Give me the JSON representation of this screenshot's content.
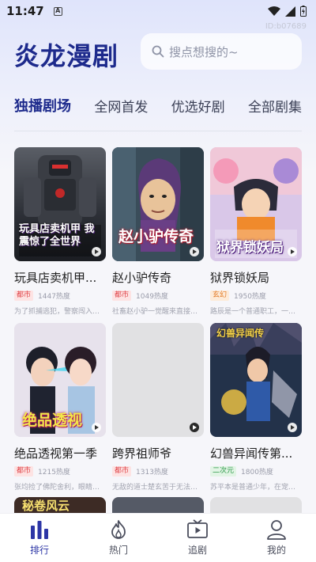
{
  "status_bar": {
    "time": "11:47",
    "notif_icon": "a-notification-icon"
  },
  "watermark": "ID:b07689",
  "header": {
    "app_title": "炎龙漫剧",
    "search_placeholder": "搜点想搜的~"
  },
  "tabs": [
    {
      "label": "独播剧场",
      "active": true
    },
    {
      "label": "全网首发",
      "active": false
    },
    {
      "label": "优选好剧",
      "active": false
    },
    {
      "label": "全部剧集",
      "active": false
    }
  ],
  "dramas": [
    {
      "title": "玩具店卖机甲...",
      "tag": "都市",
      "tag_color": "red",
      "heat": "1447热度",
      "desc": "为了抓捕逃犯，警察闯入了...",
      "cover_text": "玩具店卖机甲 我震惊了全世界"
    },
    {
      "title": "赵小驴传奇",
      "tag": "都市",
      "tag_color": "red",
      "heat": "1049热度",
      "desc": "社畜赵小驴一觉醒来直接占...",
      "cover_text": "赵小驴传奇"
    },
    {
      "title": "狱界锁妖局",
      "tag": "玄幻",
      "tag_color": "orange",
      "heat": "1950热度",
      "desc": "路辰是一个普通职工，一次...",
      "cover_text": "狱界锁妖局"
    },
    {
      "title": "绝品透视第一季",
      "tag": "都市",
      "tag_color": "red",
      "heat": "1215热度",
      "desc": "张均捡了佛陀舍利，眼睛突...",
      "cover_text": "绝品透视"
    },
    {
      "title": "跨界祖师爷",
      "tag": "都市",
      "tag_color": "red",
      "heat": "1313热度",
      "desc": "无敌的道士楚玄苦于无法飞...",
      "cover_text": ""
    },
    {
      "title": "幻兽异闻传第...",
      "tag": "二次元",
      "tag_color": "green",
      "heat": "1800热度",
      "desc": "苏平本是普通少年，在宠兽...",
      "cover_text": "幻兽异闻传"
    }
  ],
  "peek_row": {
    "first_cover_text": "秘卷风云"
  },
  "bottom_nav": [
    {
      "label": "排行",
      "icon": "bar-chart-icon",
      "active": true
    },
    {
      "label": "热门",
      "icon": "flame-icon",
      "active": false
    },
    {
      "label": "追剧",
      "icon": "tv-icon",
      "active": false
    },
    {
      "label": "我的",
      "icon": "user-icon",
      "active": false
    }
  ],
  "colors": {
    "brand": "#1d2a8c",
    "nav_active": "#2d36a6"
  }
}
